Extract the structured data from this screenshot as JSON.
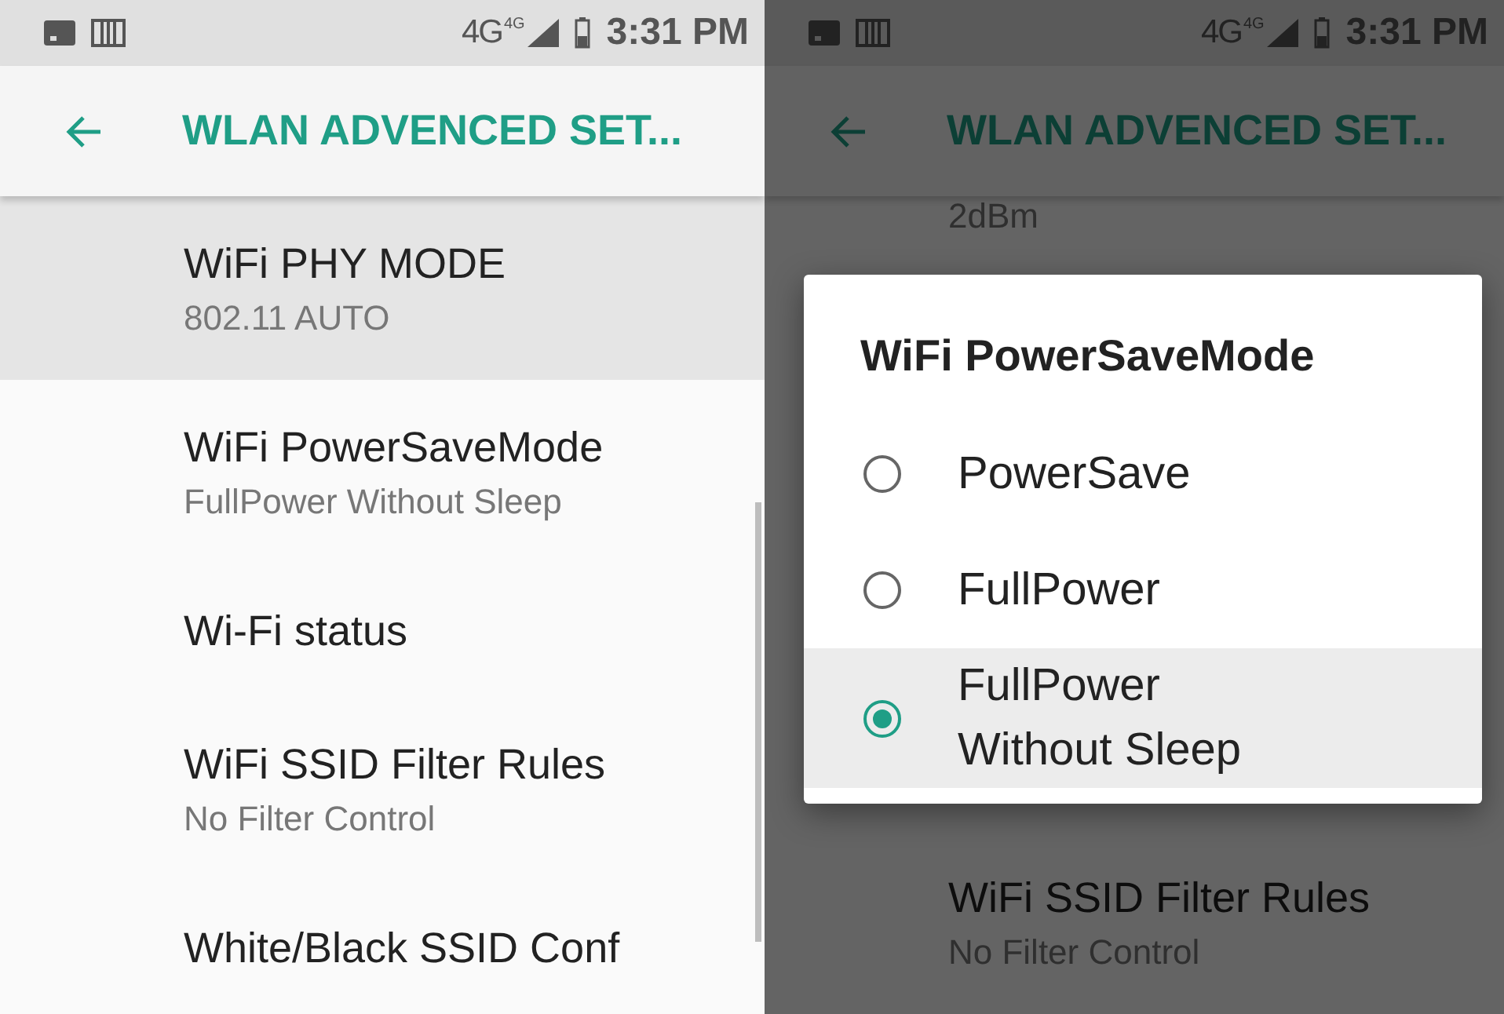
{
  "screens": [
    {
      "status_bar": {
        "network": "4G",
        "network_sup": "4G",
        "time": "3:31 PM"
      },
      "toolbar": {
        "title": "WLAN ADVENCED SET..."
      },
      "items": [
        {
          "title": "WiFi PHY MODE",
          "summary": "802.11 AUTO",
          "pressed": true
        },
        {
          "title": "WiFi PowerSaveMode",
          "summary": "FullPower Without Sleep",
          "pressed": false
        },
        {
          "title": "Wi-Fi status",
          "pressed": false
        },
        {
          "title": "WiFi SSID Filter Rules",
          "summary": "No Filter Control",
          "pressed": false
        },
        {
          "title": "White/Black SSID Conf",
          "pressed": false
        }
      ]
    },
    {
      "status_bar": {
        "network": "4G",
        "network_sup": "4G",
        "time": "3:31 PM"
      },
      "toolbar": {
        "title": "WLAN ADVENCED SET..."
      },
      "items": [
        {
          "summary": "2dBm"
        },
        {
          "title": "WiFi SSID Filter Rules",
          "summary": "No Filter Control"
        }
      ],
      "dialog": {
        "title": "WiFi PowerSaveMode",
        "options": [
          {
            "label": "PowerSave",
            "selected": false
          },
          {
            "label": "FullPower",
            "selected": false
          },
          {
            "label": "FullPower Without Sleep",
            "selected": true
          }
        ]
      }
    }
  ]
}
